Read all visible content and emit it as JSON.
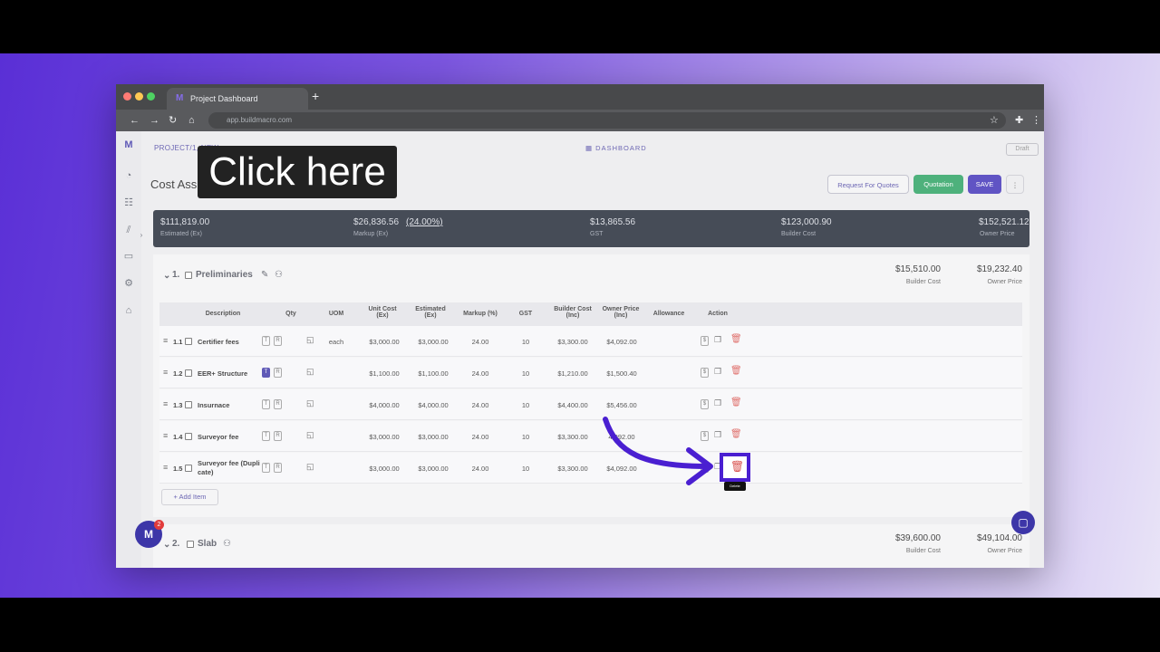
{
  "browser": {
    "tab_title": "Project Dashboard",
    "url": "app.buildmacro.com",
    "new_tab": "+"
  },
  "topbar": {
    "project": "PROJECT/1, NEW",
    "dashboard": "DASHBOARD",
    "draft": "Draft"
  },
  "page": {
    "title": "Cost Ass",
    "btn_rfq": "Request For Quotes",
    "btn_quotation": "Quotation",
    "btn_save": "SAVE"
  },
  "summary": {
    "estimated_val": "$111,819.00",
    "estimated_lbl": "Estimated (Ex)",
    "markup_val": "$26,836.56",
    "markup_pct": "(24.00%)",
    "markup_lbl": "Markup (Ex)",
    "gst_val": "$13,865.56",
    "gst_lbl": "GST",
    "builder_val": "$123,000.90",
    "builder_lbl": "Builder Cost",
    "owner_val": "$152,521.12",
    "owner_lbl": "Owner Price"
  },
  "section1": {
    "num": "1.",
    "name": "Preliminaries",
    "builder_val": "$15,510.00",
    "builder_lbl": "Builder Cost",
    "owner_val": "$19,232.40",
    "owner_lbl": "Owner Price"
  },
  "table": {
    "headers": [
      "Description",
      "Qty",
      "UOM",
      "Unit Cost (Ex)",
      "Estimated (Ex)",
      "Markup (%)",
      "GST",
      "Builder Cost (Inc)",
      "Owner Price (Inc)",
      "Allowance",
      "Action"
    ],
    "rows": [
      {
        "num": "1.1",
        "desc": "Certifier fees",
        "uom": "each",
        "unit": "$3,000.00",
        "est": "$3,000.00",
        "markup": "24.00",
        "gst": "10",
        "builder": "$3,300.00",
        "owner": "$4,092.00"
      },
      {
        "num": "1.2",
        "desc": "EER+ Structure",
        "uom": "",
        "unit": "$1,100.00",
        "est": "$1,100.00",
        "markup": "24.00",
        "gst": "10",
        "builder": "$1,210.00",
        "owner": "$1,500.40"
      },
      {
        "num": "1.3",
        "desc": "Insurnace",
        "uom": "",
        "unit": "$4,000.00",
        "est": "$4,000.00",
        "markup": "24.00",
        "gst": "10",
        "builder": "$4,400.00",
        "owner": "$5,456.00"
      },
      {
        "num": "1.4",
        "desc": "Surveyor fee",
        "uom": "",
        "unit": "$3,000.00",
        "est": "$3,000.00",
        "markup": "24.00",
        "gst": "10",
        "builder": "$3,300.00",
        "owner": "4,092.00"
      },
      {
        "num": "1.5",
        "desc": "Surveyor fee (Dupli\ncate)",
        "uom": "",
        "unit": "$3,000.00",
        "est": "$3,000.00",
        "markup": "24.00",
        "gst": "10",
        "builder": "$3,300.00",
        "owner": "$4,092.00"
      }
    ],
    "add_item": "+ Add Item"
  },
  "section2": {
    "num": "2.",
    "name": "Slab",
    "builder_val": "$39,600.00",
    "builder_lbl": "Builder Cost",
    "owner_val": "$49,104.00",
    "owner_lbl": "Owner Price"
  },
  "overlay": {
    "click_here": "Click here",
    "tooltip": "Delete",
    "badge": "2"
  },
  "colors": {
    "accent": "#4a1fd1",
    "save": "#3d2fb8",
    "quotation": "#28a060",
    "delete": "#d9534f"
  }
}
